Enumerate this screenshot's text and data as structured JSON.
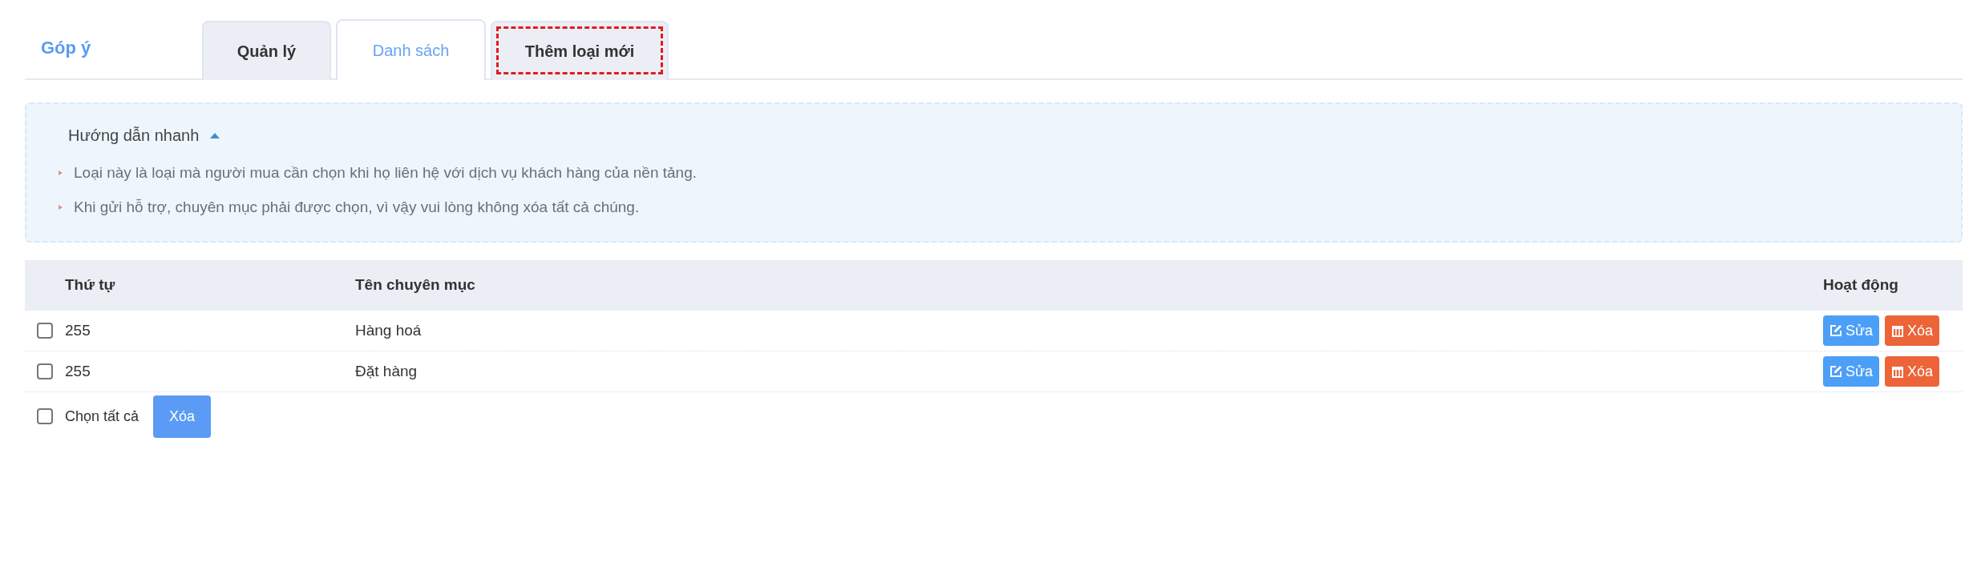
{
  "header": {
    "title": "Góp ý"
  },
  "tabs": [
    {
      "label": "Quản lý",
      "selected": false,
      "outlined": false
    },
    {
      "label": "Danh sách",
      "selected": true,
      "outlined": false
    },
    {
      "label": "Thêm loại mới",
      "selected": false,
      "outlined": true
    }
  ],
  "guide": {
    "title": "Hướng dẫn nhanh",
    "expanded": true,
    "items": [
      "Loại này là loại mà người mua cần chọn khi họ liên hệ với dịch vụ khách hàng của nền tảng.",
      "Khi gửi hỗ trợ, chuyên mục phải được chọn, vì vậy vui lòng không xóa tất cả chúng."
    ]
  },
  "table": {
    "columns": [
      "Thứ tự",
      "Tên chuyên mục",
      "Hoạt động"
    ],
    "rows": [
      {
        "checked": false,
        "order": "255",
        "name": "Hàng hoá",
        "edit": "Sửa",
        "delete": "Xóa"
      },
      {
        "checked": false,
        "order": "255",
        "name": "Đặt hàng",
        "edit": "Sửa",
        "delete": "Xóa"
      }
    ]
  },
  "footer": {
    "select_all": {
      "label": "Chọn tất cả",
      "checked": false
    },
    "delete_button": "Xóa"
  }
}
